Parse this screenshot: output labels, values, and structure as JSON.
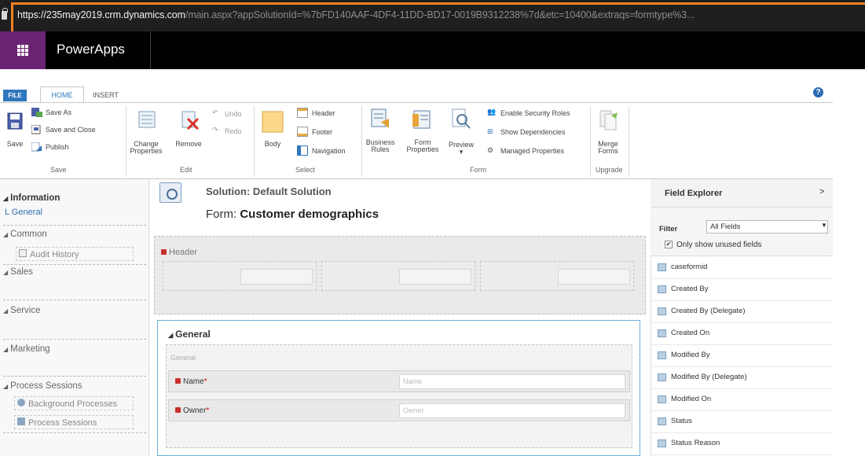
{
  "address_bar": {
    "host": "https://235may2019.crm.dynamics.com",
    "path": "/main.aspx?appSolutionId=%7bFD140AAF-4DF4-11DD-BD17-0019B9312238%7d&etc=10400&extraqs=formtype%3..."
  },
  "app": {
    "name": "PowerApps"
  },
  "ribbon_tabs": {
    "file": "FILE",
    "home": "HOME",
    "insert": "INSERT",
    "help": "?"
  },
  "ribbon": {
    "save": {
      "label": "Save",
      "save_as": "Save As",
      "save_close": "Save and Close",
      "publish": "Publish",
      "group": "Save"
    },
    "edit": {
      "change_properties_1": "Change",
      "change_properties_2": "Properties",
      "remove": "Remove",
      "undo": "Undo",
      "redo": "Redo",
      "group": "Edit"
    },
    "select": {
      "body": "Body",
      "header": "Header",
      "footer": "Footer",
      "navigation": "Navigation",
      "group": "Select"
    },
    "form": {
      "business_rules_1": "Business",
      "business_rules_2": "Rules",
      "form_properties_1": "Form",
      "form_properties_2": "Properties",
      "preview": "Preview",
      "enable_security_roles": "Enable Security Roles",
      "show_dependencies": "Show Dependencies",
      "managed_properties": "Managed Properties",
      "group": "Form"
    },
    "upgrade": {
      "merge_forms_1": "Merge",
      "merge_forms_2": "Forms",
      "group": "Upgrade"
    }
  },
  "left_nav": {
    "information": "Information",
    "general": "General",
    "common": "Common",
    "audit_history": "Audit History",
    "sales": "Sales",
    "service": "Service",
    "marketing": "Marketing",
    "process_sessions": "Process Sessions",
    "background_processes": "Background Processes",
    "process_sessions_item": "Process Sessions"
  },
  "form": {
    "solution": "Solution: Default Solution",
    "form_prefix": "Form: ",
    "form_name": "Customer demographics",
    "header_label": "Header",
    "general_title": "General",
    "general_sub": "General",
    "fields": [
      {
        "label": "Name",
        "placeholder": "Name"
      },
      {
        "label": "Owner",
        "placeholder": "Owner"
      }
    ]
  },
  "field_explorer": {
    "title": "Field Explorer",
    "chevron": ">",
    "filter_label": "Filter",
    "filter_value": "All Fields",
    "only_unused": "Only show unused fields",
    "only_unused_checked": true,
    "fields": [
      "caseformid",
      "Created By",
      "Created By (Delegate)",
      "Created On",
      "Modified By",
      "Modified By (Delegate)",
      "Modified On",
      "Status",
      "Status Reason"
    ]
  }
}
